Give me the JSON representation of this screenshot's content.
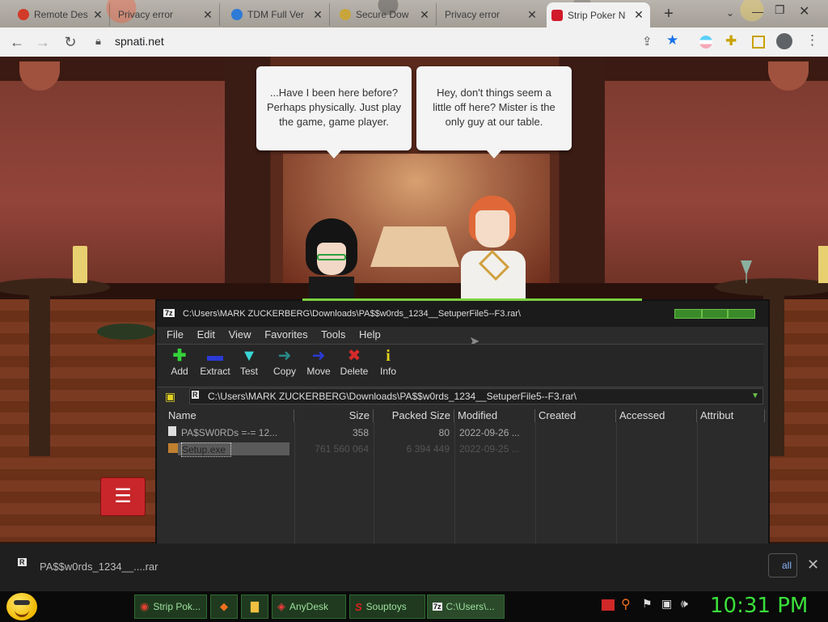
{
  "browser": {
    "tabs": [
      {
        "title": "Remote Des",
        "fav_color": "#d23a2a"
      },
      {
        "title": "Privacy error",
        "fav_color": "#c9c2ba"
      },
      {
        "title": "TDM Full Ver",
        "fav_color": "#2d7bd6"
      },
      {
        "title": "Secure Dow",
        "fav_color": "#c8a53a"
      },
      {
        "title": "Privacy error",
        "fav_color": "#c9c2ba"
      },
      {
        "title": "Strip Poker N",
        "fav_color": "#d11a2a"
      }
    ],
    "new_tab_label": "+",
    "url": "spnati.net"
  },
  "game": {
    "bubble_left": "...Have I been here before? Perhaps physically. Just play the game, game player.",
    "bubble_right": "Hey, don't things seem a little off here? Mister is the only guy at our table."
  },
  "zip": {
    "title": "C:\\Users\\MARK ZUCKERBERG\\Downloads\\PA$$w0rds_1234__SetuperFile5--F3.rar\\",
    "menu": [
      "File",
      "Edit",
      "View",
      "Favorites",
      "Tools",
      "Help"
    ],
    "toolbar": [
      {
        "label": "Add",
        "icon": "+",
        "color": "#34d23a"
      },
      {
        "label": "Extract",
        "icon": "▬",
        "color": "#2a3ad6"
      },
      {
        "label": "Test",
        "icon": "▼",
        "color": "#3ad6d6"
      },
      {
        "label": "Copy",
        "icon": "➜",
        "color": "#2a8a8a"
      },
      {
        "label": "Move",
        "icon": "➜",
        "color": "#2a3ad6"
      },
      {
        "label": "Delete",
        "icon": "✖",
        "color": "#d62a2a"
      },
      {
        "label": "Info",
        "icon": "i",
        "color": "#e0d020"
      }
    ],
    "path": "C:\\Users\\MARK ZUCKERBERG\\Downloads\\PA$$w0rds_1234__SetuperFile5--F3.rar\\",
    "columns": [
      "Name",
      "Size",
      "Packed Size",
      "Modified",
      "Created",
      "Accessed",
      "Attribut"
    ],
    "rows": [
      {
        "name": "PA$SW0RDs =-= 12...",
        "size": "358",
        "packed": "80",
        "modified": "2022-09-26 ..."
      },
      {
        "name": "Setup.exe",
        "size": "761 560 064",
        "packed": "6 394 449",
        "modified": "2022-09-25 ..."
      }
    ]
  },
  "download": {
    "filename": "PA$$w0rds_1234__....rar",
    "show_all": "all"
  },
  "taskbar": {
    "items": [
      {
        "label": "Strip Pok...",
        "icon": "◉"
      },
      {
        "label": "",
        "icon": "◆"
      },
      {
        "label": "",
        "icon": "▇"
      },
      {
        "label": "AnyDesk",
        "icon": "◈"
      },
      {
        "label": "Souptoys",
        "icon": "S"
      },
      {
        "label": "C:\\Users\\...",
        "icon": "7z"
      }
    ],
    "clock": "10:31 PM"
  }
}
